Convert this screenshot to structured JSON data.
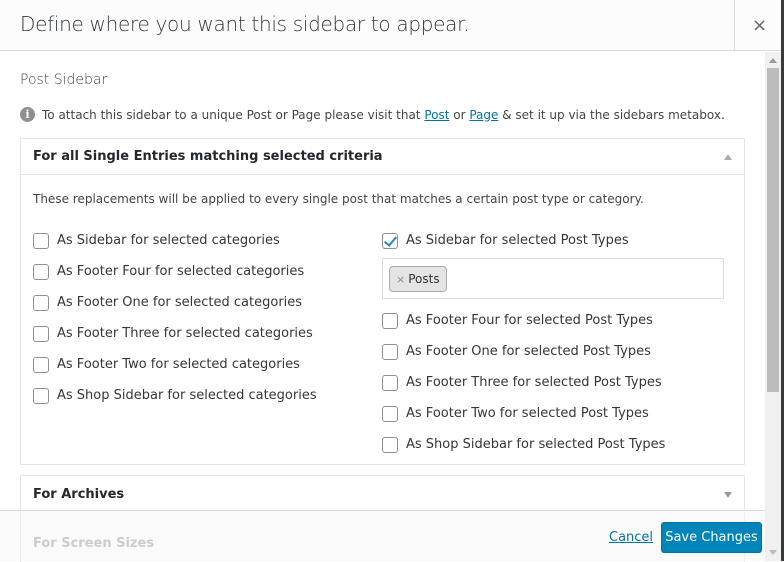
{
  "modal": {
    "title": "Define where you want this sidebar to appear.",
    "close_label": "×"
  },
  "body": {
    "section_title": "Post Sidebar",
    "info": {
      "prefix": "To attach this sidebar to a unique Post or Page please visit that ",
      "post_link": "Post",
      "middle": " or ",
      "page_link": "Page",
      "suffix": " & set it up via the sidebars metabox."
    },
    "single_panel": {
      "title": "For all Single Entries matching selected criteria",
      "description": "These replacements will be applied to every single post that matches a certain post type or category.",
      "categories": [
        {
          "label": "As Sidebar for selected categories",
          "checked": false
        },
        {
          "label": "As Footer Four for selected categories",
          "checked": false
        },
        {
          "label": "As Footer One for selected categories",
          "checked": false
        },
        {
          "label": "As Footer Three for selected categories",
          "checked": false
        },
        {
          "label": "As Footer Two for selected categories",
          "checked": false
        },
        {
          "label": "As Shop Sidebar for selected categories",
          "checked": false
        }
      ],
      "post_types": [
        {
          "label": "As Sidebar for selected Post Types",
          "checked": true
        },
        {
          "label": "As Footer Four for selected Post Types",
          "checked": false
        },
        {
          "label": "As Footer One for selected Post Types",
          "checked": false
        },
        {
          "label": "As Footer Three for selected Post Types",
          "checked": false
        },
        {
          "label": "As Footer Two for selected Post Types",
          "checked": false
        },
        {
          "label": "As Shop Sidebar for selected Post Types",
          "checked": false
        }
      ],
      "selected_tags": [
        {
          "label": "Posts",
          "remove": "×"
        }
      ]
    },
    "archives_panel": {
      "title": "For Archives"
    },
    "screen_sizes_panel": {
      "title": "For Screen Sizes"
    }
  },
  "footer": {
    "cancel_label": "Cancel",
    "save_label": "Save Changes"
  },
  "colors": {
    "primary_button": "#0085ba",
    "link": "#0073aa",
    "checkmark": "#1e8cbe"
  }
}
